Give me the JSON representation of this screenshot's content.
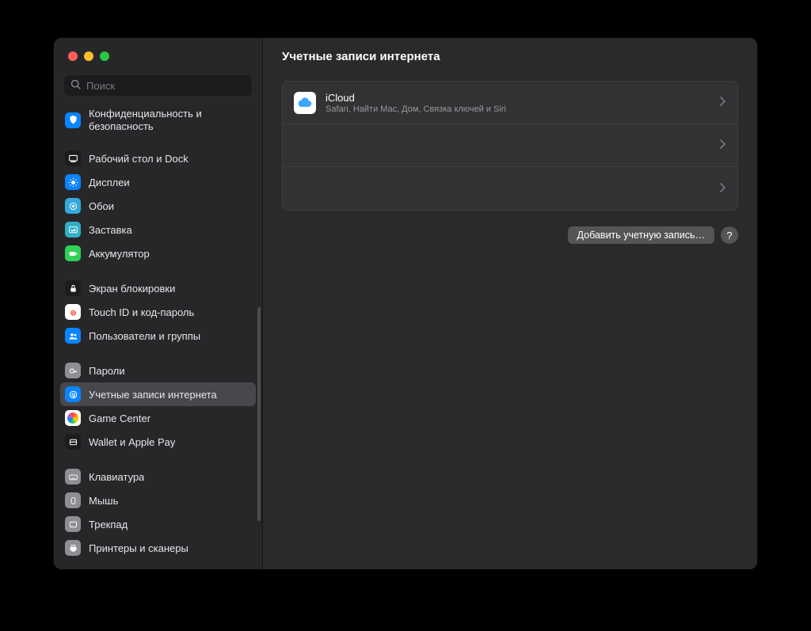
{
  "header": {
    "title": "Учетные записи интернета"
  },
  "search": {
    "placeholder": "Поиск"
  },
  "sidebar": {
    "items": [
      {
        "label": "Конфиденциальность и безопасность",
        "icon": "privacy-icon"
      },
      {
        "label": "Рабочий стол и Dock",
        "icon": "desktop-dock-icon"
      },
      {
        "label": "Дисплеи",
        "icon": "displays-icon"
      },
      {
        "label": "Обои",
        "icon": "wallpaper-icon"
      },
      {
        "label": "Заставка",
        "icon": "screensaver-icon"
      },
      {
        "label": "Аккумулятор",
        "icon": "battery-icon"
      },
      {
        "label": "Экран блокировки",
        "icon": "lock-screen-icon"
      },
      {
        "label": "Touch ID и код-пароль",
        "icon": "touchid-icon"
      },
      {
        "label": "Пользователи и группы",
        "icon": "users-groups-icon"
      },
      {
        "label": "Пароли",
        "icon": "passwords-icon"
      },
      {
        "label": "Учетные записи интернета",
        "icon": "internet-accounts-icon"
      },
      {
        "label": "Game Center",
        "icon": "game-center-icon"
      },
      {
        "label": "Wallet и Apple Pay",
        "icon": "wallet-icon"
      },
      {
        "label": "Клавиатура",
        "icon": "keyboard-icon"
      },
      {
        "label": "Мышь",
        "icon": "mouse-icon"
      },
      {
        "label": "Трекпад",
        "icon": "trackpad-icon"
      },
      {
        "label": "Принтеры и сканеры",
        "icon": "printers-icon"
      }
    ],
    "selected_index": 10
  },
  "main": {
    "accounts": [
      {
        "title": "iCloud",
        "subtitle": "Safari, Найти Mac, Дом, Связка ключей и Siri",
        "icon": "icloud-icon"
      },
      {
        "title": "",
        "subtitle": "",
        "icon": ""
      },
      {
        "title": "",
        "subtitle": "",
        "icon": ""
      }
    ],
    "add_button": "Добавить учетную запись…",
    "help_label": "?"
  },
  "colors": {
    "accent": "#0a84ff",
    "window_bg": "#2a2a2c",
    "sidebar_bg": "#27272a",
    "selected_bg": "#48484c"
  }
}
